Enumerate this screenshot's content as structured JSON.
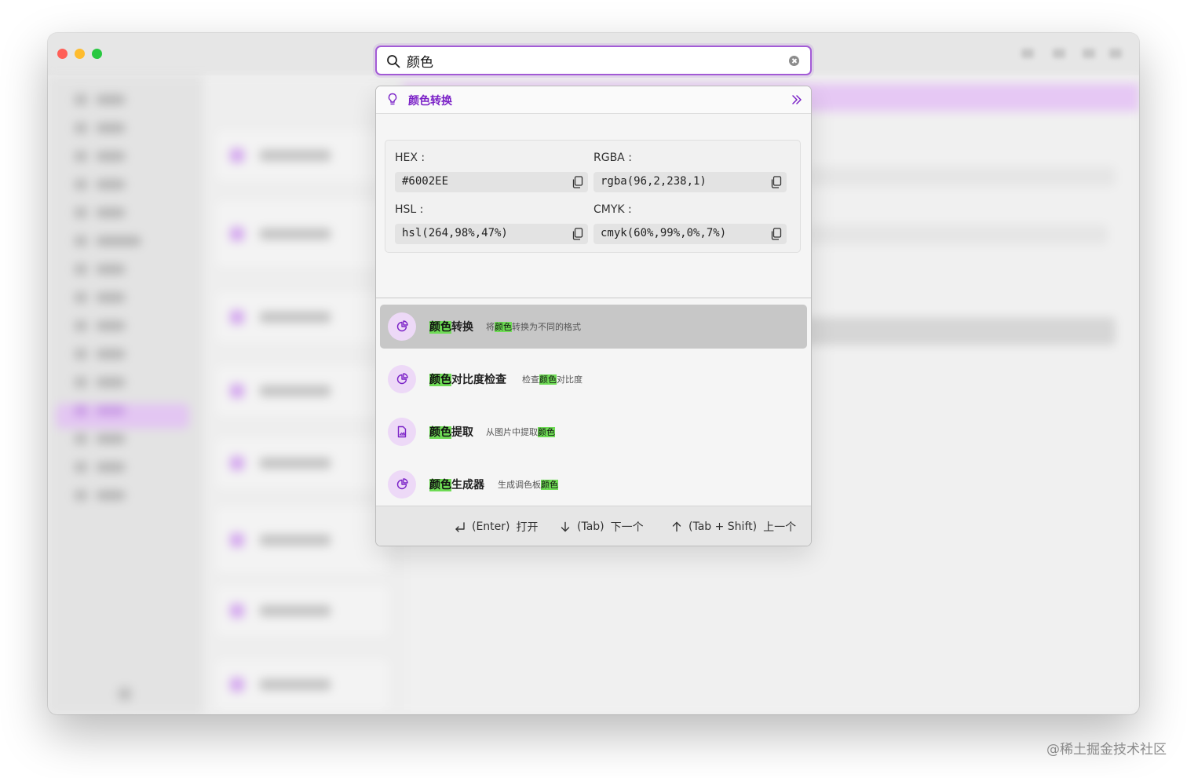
{
  "search": {
    "value": "颜色",
    "placeholder": ""
  },
  "panel": {
    "title": "颜色转换"
  },
  "color_formats": [
    {
      "label": "HEX :",
      "value": "#6002EE"
    },
    {
      "label": "RGBA :",
      "value": "rgba(96,2,238,1)"
    },
    {
      "label": "HSL :",
      "value": "hsl(264,98%,47%)"
    },
    {
      "label": "CMYK :",
      "value": "cmyk(60%,99%,0%,7%)"
    }
  ],
  "results": [
    {
      "name_hl": "颜色",
      "name_rest": "转换",
      "desc_pre": "将",
      "desc_hl": "颜色",
      "desc_post": "转换为不同的格式",
      "icon": "pie-chart-icon",
      "selected": true
    },
    {
      "name_hl": "颜色",
      "name_rest": "对比度检查",
      "desc_pre": "检查",
      "desc_hl": "颜色",
      "desc_post": "对比度",
      "icon": "pie-chart-icon",
      "selected": false
    },
    {
      "name_hl": "颜色",
      "name_rest": "提取",
      "desc_pre": "从图片中提取",
      "desc_hl": "颜色",
      "desc_post": "",
      "icon": "file-image-icon",
      "selected": false
    },
    {
      "name_hl": "颜色",
      "name_rest": "生成器",
      "desc_pre": "生成调色板",
      "desc_hl": "颜色",
      "desc_post": "",
      "icon": "pie-chart-icon",
      "selected": false
    }
  ],
  "footer": {
    "open_key": "(Enter)",
    "open_label": "打开",
    "next_key": "(Tab)",
    "next_label": "下一个",
    "prev_key": "(Tab + Shift)",
    "prev_label": "上一个"
  },
  "colors": {
    "accent": "#7b22c7",
    "highlight": "#6edb55",
    "swatch": "#6002EE"
  },
  "watermark": "@稀土掘金技术社区"
}
